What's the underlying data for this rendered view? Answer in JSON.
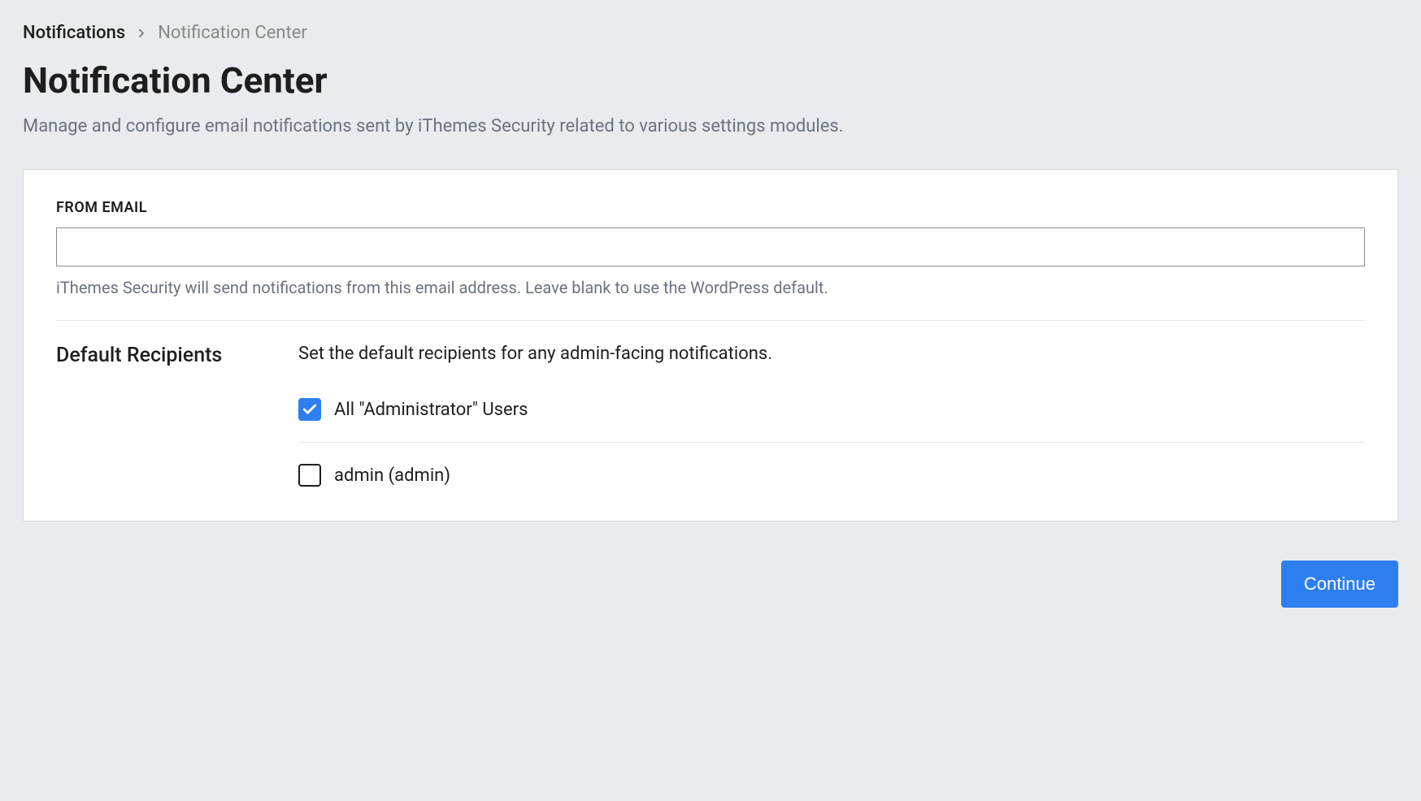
{
  "breadcrumb": {
    "parent": "Notifications",
    "current": "Notification Center"
  },
  "header": {
    "title": "Notification Center",
    "description": "Manage and configure email notifications sent by iThemes Security related to various settings modules."
  },
  "form": {
    "from_email": {
      "label": "FROM EMAIL",
      "value": "",
      "hint": "iThemes Security will send notifications from this email address. Leave blank to use the WordPress default."
    },
    "recipients": {
      "title": "Default Recipients",
      "description": "Set the default recipients for any admin-facing notifications.",
      "options": [
        {
          "label": "All \"Administrator\" Users",
          "checked": true
        },
        {
          "label": "admin (admin)",
          "checked": false
        }
      ]
    }
  },
  "actions": {
    "continue_label": "Continue"
  },
  "colors": {
    "accent": "#2d7ff0",
    "background": "#e9ebee"
  }
}
